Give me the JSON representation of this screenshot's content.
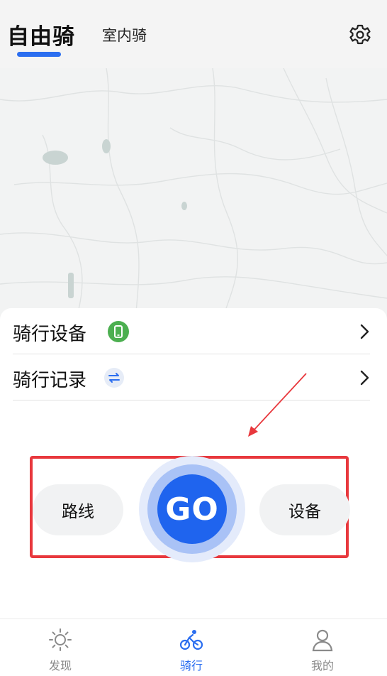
{
  "header": {
    "tab_active": "自由骑",
    "tab_inactive": "室内骑",
    "settings_icon": "gear-icon"
  },
  "colors": {
    "accent": "#2b6ef0",
    "go_button": "#1f64ee",
    "annotation": "#e8383d",
    "device_badge": "#4caf50"
  },
  "list": {
    "items": [
      {
        "label": "骑行设备",
        "icon": "phone-icon"
      },
      {
        "label": "骑行记录",
        "icon": "swap-icon"
      }
    ]
  },
  "actions": {
    "route_label": "路线",
    "go_label": "GO",
    "device_label": "设备"
  },
  "bottom_nav": {
    "items": [
      {
        "label": "发现",
        "icon": "sun-icon",
        "active": false
      },
      {
        "label": "骑行",
        "icon": "bicycle-icon",
        "active": true
      },
      {
        "label": "我的",
        "icon": "person-icon",
        "active": false
      }
    ]
  }
}
